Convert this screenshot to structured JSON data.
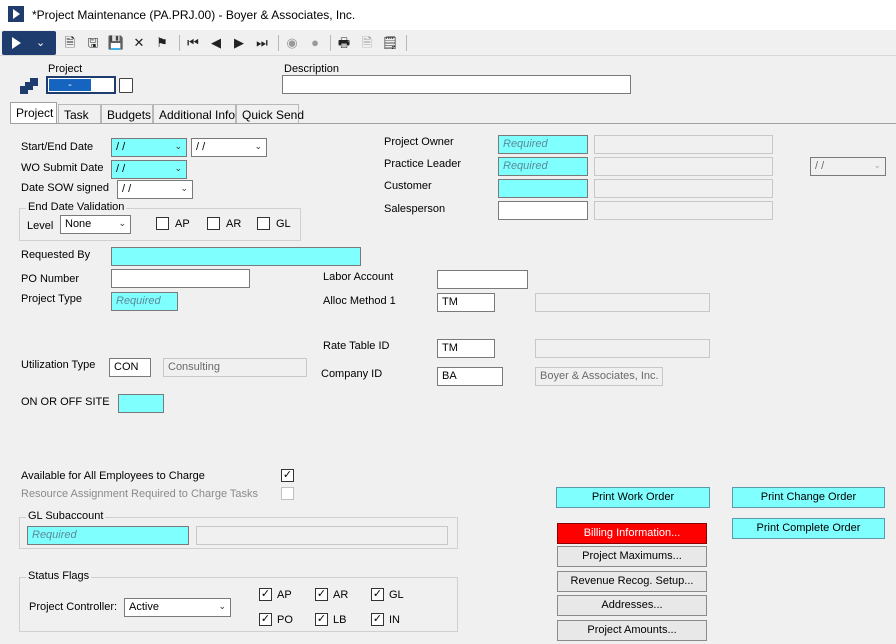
{
  "window": {
    "title": "*Project Maintenance (PA.PRJ.00) - Boyer & Associates, Inc."
  },
  "toolbar": {
    "buttons": [
      "new-icon",
      "save-icon",
      "save-close-icon",
      "delete-icon",
      "cancel-icon",
      "first-icon",
      "previous-icon",
      "next-icon",
      "last-icon",
      "connect-icon",
      "attach-icon",
      "print-icon",
      "copy-icon",
      "notes-icon"
    ]
  },
  "header": {
    "project_label": "Project",
    "project_value": "-",
    "description_label": "Description",
    "description_value": ""
  },
  "tabs": [
    "Project",
    "Task",
    "Budgets",
    "Additional Info",
    "Quick Send"
  ],
  "form": {
    "start_end_label": "Start/End Date",
    "start_date": " / /",
    "end_date": " / /",
    "wo_submit_label": "WO Submit Date",
    "wo_submit_date": " / /",
    "sow_signed_label": "Date SOW signed",
    "sow_signed_date": " / /",
    "end_date_validation_label": "End Date Validation",
    "level_label": "Level",
    "level_value": "None",
    "ap_label": "AP",
    "ar_label": "AR",
    "gl_label": "GL",
    "project_owner_label": "Project Owner",
    "project_owner_value": "Required",
    "practice_leader_label": "Practice Leader",
    "practice_leader_value": "Required",
    "practice_leader_date": " / /",
    "customer_label": "Customer",
    "salesperson_label": "Salesperson",
    "requested_by_label": "Requested By",
    "po_number_label": "PO Number",
    "project_type_label": "Project Type",
    "project_type_value": "Required",
    "labor_account_label": "Labor Account",
    "alloc_method_label": "Alloc Method 1",
    "alloc_method_value": "TM",
    "rate_table_label": "Rate Table ID",
    "rate_table_value": "TM",
    "utilization_type_label": "Utilization Type",
    "utilization_type_value": "CON",
    "utilization_type_desc": "Consulting",
    "company_id_label": "Company ID",
    "company_id_value": "BA",
    "company_name": "Boyer & Associates, Inc.",
    "on_off_site_label": "ON OR OFF SITE",
    "available_all_label": "Available for All Employees to Charge",
    "resource_assignment_label": "Resource Assignment Required to Charge Tasks",
    "gl_subaccount_label": "GL Subaccount",
    "gl_subaccount_value": "Required",
    "status_flags_label": "Status Flags",
    "project_controller_label": "Project Controller:",
    "project_controller_value": "Active",
    "flag_ap": "AP",
    "flag_ar": "AR",
    "flag_gl": "GL",
    "flag_po": "PO",
    "flag_lb": "LB",
    "flag_in": "IN"
  },
  "buttons": {
    "print_work_order": "Print Work Order",
    "print_change_order": "Print Change Order",
    "billing_information": "Billing Information...",
    "print_complete_order": "Print Complete Order",
    "project_maximums": "Project Maximums...",
    "revenue_recog": "Revenue Recog. Setup...",
    "addresses": "Addresses...",
    "project_amounts": "Project Amounts..."
  },
  "colors": {
    "required_bg": "#80ffff",
    "billing_bg": "#ff0000",
    "brand": "#1e3c6e"
  }
}
